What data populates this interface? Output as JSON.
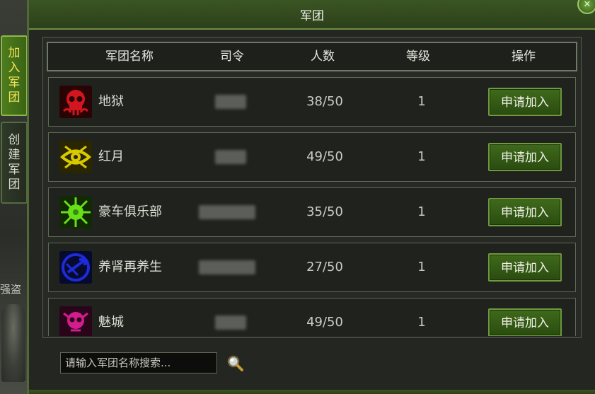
{
  "window": {
    "title": "军团",
    "close_symbol": "✕"
  },
  "side_tabs": [
    {
      "label": [
        "加",
        "入",
        "军",
        "团"
      ],
      "active": true
    },
    {
      "label": [
        "创",
        "建",
        "军",
        "团"
      ],
      "active": false
    }
  ],
  "background_text": "强盗",
  "table": {
    "headers": [
      "军团名称",
      "司令",
      "人数",
      "等级",
      "操作"
    ],
    "rows": [
      {
        "name": "地狱",
        "members": "38/50",
        "level": "1",
        "action": "申请加入",
        "emblem": "red-skull-icon",
        "color": "#d3151f"
      },
      {
        "name": "红月",
        "members": "49/50",
        "level": "1",
        "action": "申请加入",
        "emblem": "yellow-eye-icon",
        "color": "#d9c900"
      },
      {
        "name": "豪车俱乐部",
        "members": "35/50",
        "level": "1",
        "action": "申请加入",
        "emblem": "green-splat-icon",
        "color": "#66e01a"
      },
      {
        "name": "养肾再养生",
        "members": "27/50",
        "level": "1",
        "action": "申请加入",
        "emblem": "blue-trident-icon",
        "color": "#1d2bd8"
      },
      {
        "name": "魅城",
        "members": "49/50",
        "level": "1",
        "action": "申请加入",
        "emblem": "pink-skull-icon",
        "color": "#d31d8f"
      }
    ]
  },
  "search": {
    "placeholder": "请输入军团名称搜索..."
  },
  "colors": {
    "accent_green": "#3f6a1b",
    "tab_active_text": "#f3e25a",
    "frame_green": "#4f6a35"
  }
}
